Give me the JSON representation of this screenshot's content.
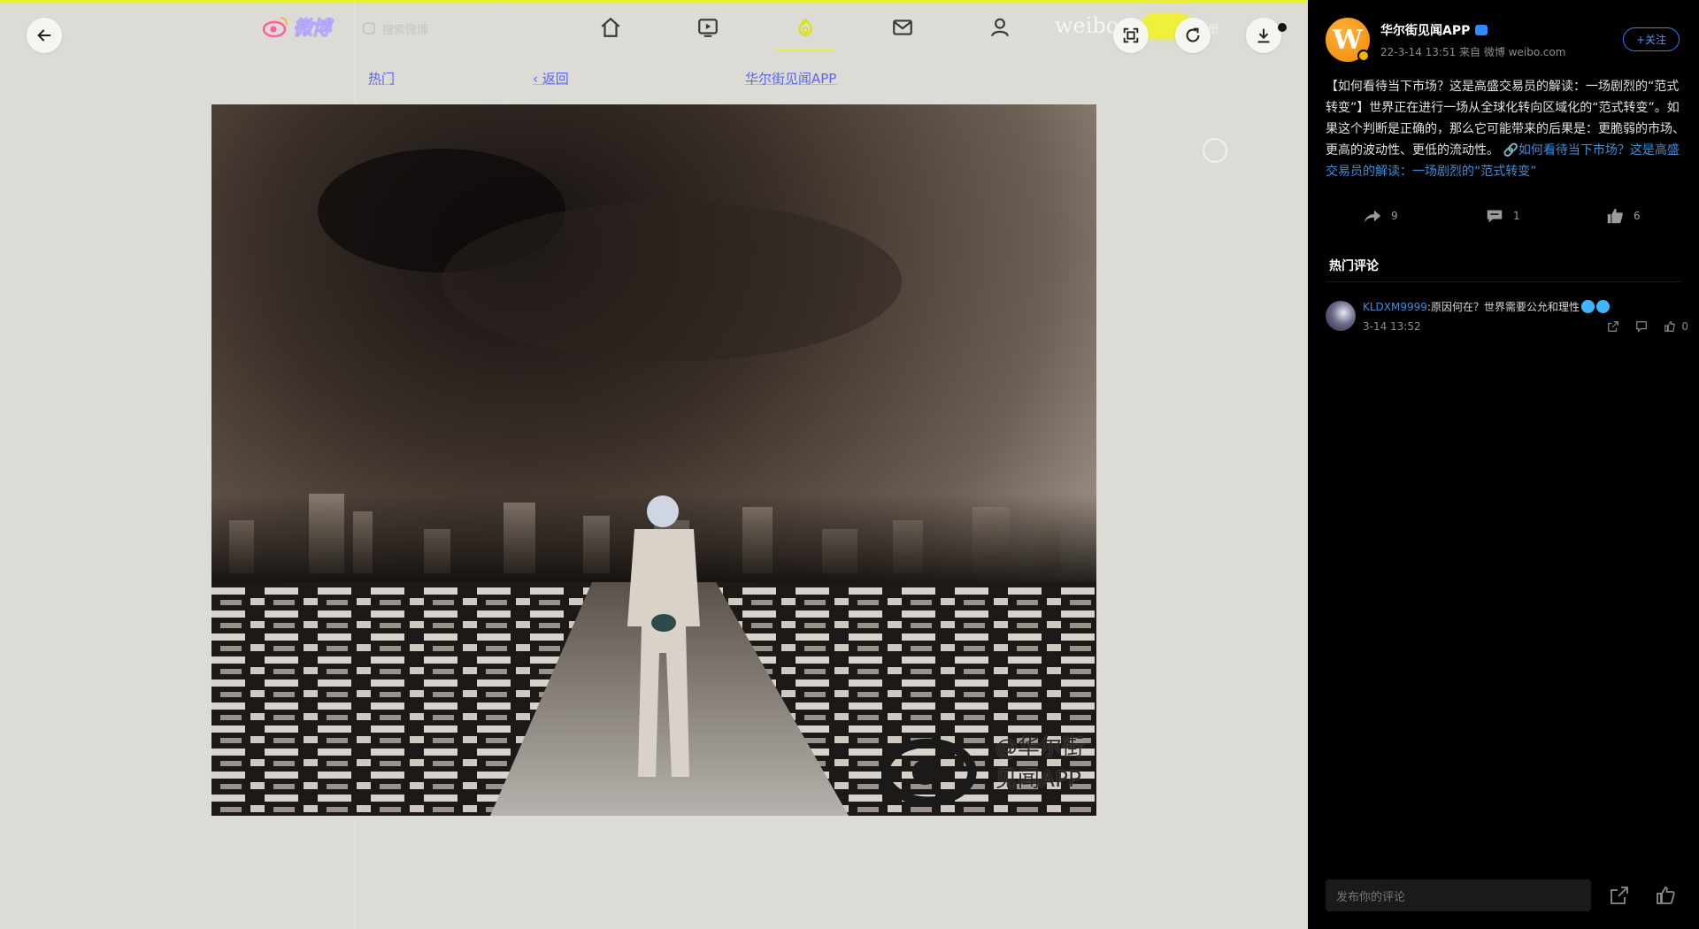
{
  "nav": {
    "logo_text": "微博",
    "search_placeholder": "搜索微博",
    "weibo_ghost": "weibo",
    "ghost_right": "注册"
  },
  "sub_tabs": {
    "hot": "热门",
    "back": "返回",
    "author": "华尔街见闻APP"
  },
  "photo": {
    "watermark": "@华尔街见闻APP"
  },
  "post": {
    "author_name": "华尔街见闻APP",
    "meta": "22-3-14 13:51 来自 微博 weibo.com",
    "follow_label": "+关注",
    "text_main": "【如何看待当下市场？这是高盛交易员的解读：一场剧烈的“范式转变”】世界正在进行一场从全球化转向区域化的“范式转变”。如果这个判断是正确的，那么它可能带来的后果是：更脆弱的市场、更高的波动性、更低的流动性。",
    "text_link": "如何看待当下市场？这是高盛交易员的解读：一场剧烈的“范式转变”",
    "reposts": "9",
    "comments": "1",
    "likes": "6"
  },
  "hot_comments": {
    "title": "热门评论",
    "items": [
      {
        "user": "KLDXM9999",
        "text": ":原因何在？世界需要公允和理性",
        "time": "3-14 13:52",
        "likes": "0"
      }
    ]
  },
  "compose": {
    "placeholder": "发布你的评论"
  },
  "colors": {
    "accent_yellow": "#e7ef34",
    "link_blue": "#3e8fd9",
    "follow_blue": "#3b7bff",
    "panel_bg": "#000000",
    "viewer_bg": "#dcdbd6"
  },
  "icons": {
    "back": "arrow-left-icon",
    "home": "home-icon",
    "video": "video-icon",
    "hot": "flame-icon",
    "mail": "mail-icon",
    "user": "user-icon",
    "fit": "fit-screen-icon",
    "rotate": "rotate-icon",
    "download": "download-icon"
  }
}
